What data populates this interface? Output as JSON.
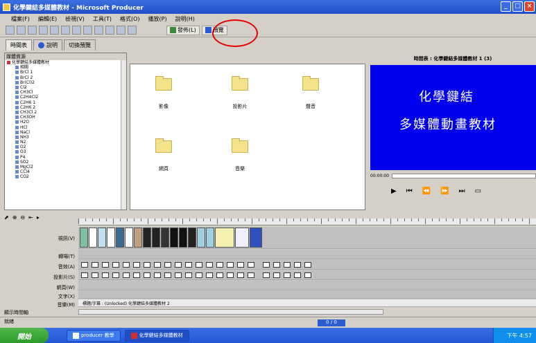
{
  "window": {
    "title": "化學鍵結多媒體教材 - Microsoft Producer"
  },
  "menu": [
    "檔案(F)",
    "編輯(E)",
    "檢視(V)",
    "工具(T)",
    "格式(O)",
    "播放(P)",
    "說明(H)"
  ],
  "toolbar": {
    "publish_label": "發佈(L)",
    "preview_label": "預覽"
  },
  "tabs": [
    "時間表",
    "說明",
    "切換預覽"
  ],
  "tree": {
    "header": "媒體資源",
    "root": "化學鍵結多媒體教材",
    "items": [
      "相關",
      "BrCl 1",
      "BrCl 2",
      "Br(Cl)2",
      "Cl2",
      "CH3Cl",
      "C2H4Cl2",
      "C2H6 1",
      "C2H6 2",
      "CH3Cl 2",
      "CH3OH",
      "H2O",
      "HCl",
      "NaCl",
      "NH3",
      "N2",
      "O2",
      "O3",
      "P4",
      "SO2",
      "MgCl2",
      "CCl4",
      "CO2"
    ]
  },
  "folders": [
    "影像",
    "投影片",
    "聲音",
    "網頁",
    "音樂"
  ],
  "preview": {
    "title": "時間表 : 化學鍵結多媒體教材 1 (3)",
    "line1": "化學鍵結",
    "line2": "多媒體動畫教材",
    "seek_label": "00:00:00"
  },
  "timeline": {
    "tracks": [
      "視訊(V)",
      "轉場(T)",
      "音效(A)",
      "投影片(S)",
      "網頁(W)",
      "文字(X)",
      "音樂(M)"
    ],
    "title_clip": "標題/字幕 : (Unlocked) 化學鍵結多媒體教材 2"
  },
  "status": {
    "zoom_label": "顯示時間軸",
    "ready": "就緒",
    "count": "0 / 0"
  },
  "taskbar": {
    "start": "開始",
    "items": [
      "producer 教學",
      "化學鍵結多媒體教材"
    ],
    "clock": "下午 4:57"
  }
}
